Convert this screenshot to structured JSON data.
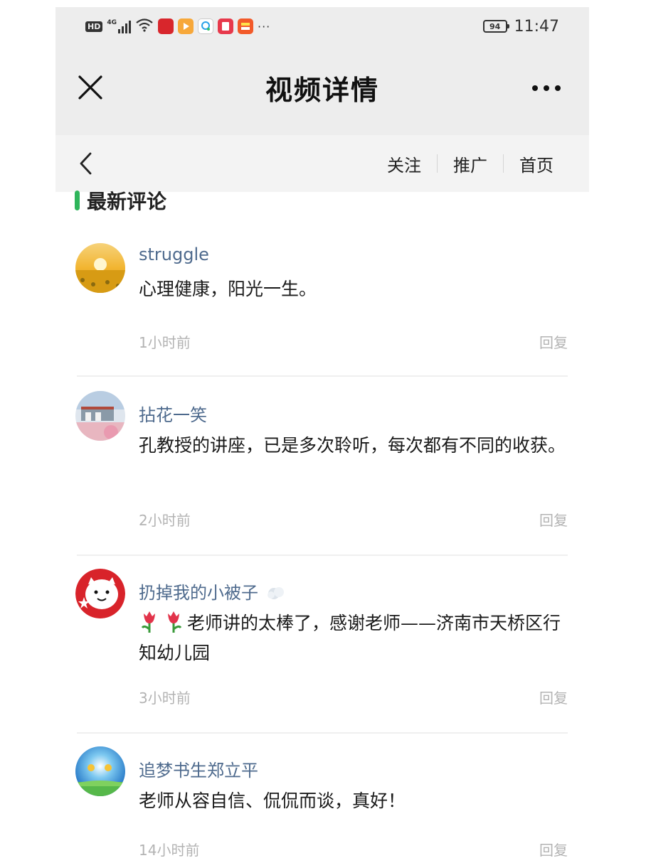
{
  "status_bar": {
    "hd": "HD",
    "network": "4G",
    "battery": "94",
    "time": "11:47",
    "more_dots": "···"
  },
  "header": {
    "title": "视频详情",
    "close_icon": "close-icon",
    "more_icon": "more-horizontal-icon"
  },
  "subnav": {
    "back_icon": "chevron-left-icon",
    "links": [
      "关注",
      "推广",
      "首页"
    ]
  },
  "section": {
    "title": "最新评论",
    "accent_color": "#2fb55b"
  },
  "comments": [
    {
      "name": "struggle",
      "text": "心理健康，阳光一生。",
      "time": "1小时前",
      "reply": "回复"
    },
    {
      "name": "拈花一笑",
      "text": "孔教授的讲座，已是多次聆听，每次都有不同的收获。",
      "time": "2小时前",
      "reply": "回复"
    },
    {
      "name": "扔掉我的小被子",
      "text": "老师讲的太棒了，感谢老师——济南市天桥区行知幼儿园",
      "time": "3小时前",
      "reply": "回复"
    },
    {
      "name": "追梦书生郑立平",
      "text": "老师从容自信、侃侃而谈，真好！",
      "time": "14小时前",
      "reply": "回复"
    }
  ],
  "colors": {
    "name_blue": "#4e6a8d",
    "meta_gray": "#b3b3b3",
    "header_bg": "#ededed"
  }
}
